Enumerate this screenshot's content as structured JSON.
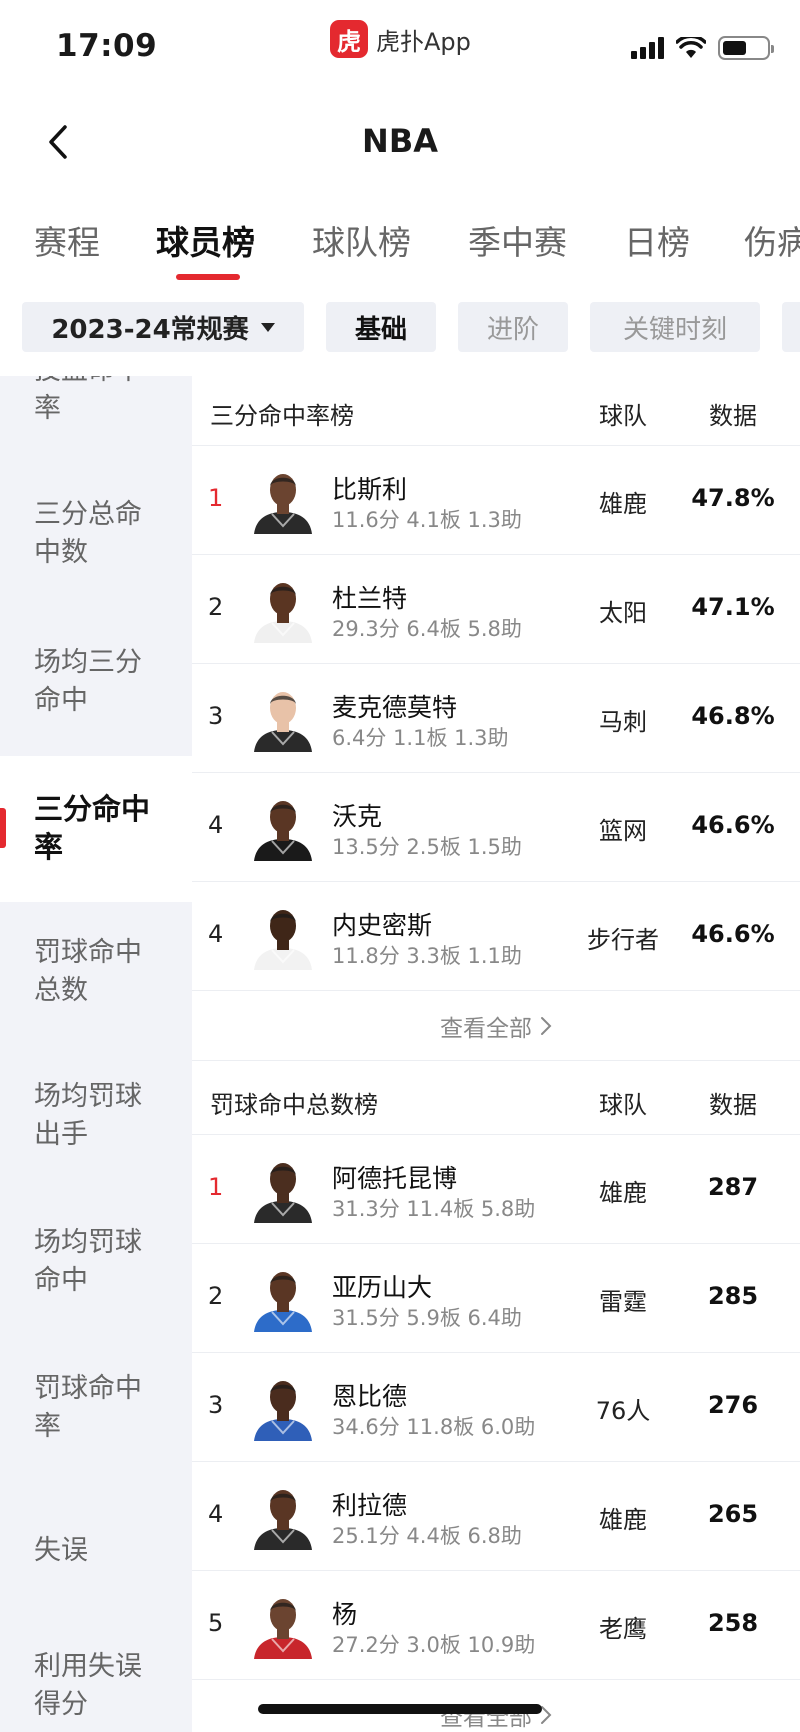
{
  "status_bar": {
    "time": "17:09",
    "app_logo_char": "虎",
    "app_name": "虎扑App"
  },
  "header": {
    "title": "NBA"
  },
  "tabs": [
    {
      "label": "赛程",
      "active": false
    },
    {
      "label": "球员榜",
      "active": true
    },
    {
      "label": "球队榜",
      "active": false
    },
    {
      "label": "季中赛",
      "active": false
    },
    {
      "label": "日榜",
      "active": false
    },
    {
      "label": "伤病",
      "active": false
    }
  ],
  "filters": {
    "season": "2023-24常规赛",
    "options": [
      {
        "label": "基础",
        "active": true
      },
      {
        "label": "进阶",
        "active": false
      },
      {
        "label": "关键时刻",
        "active": false
      }
    ]
  },
  "sidebar": {
    "items": [
      {
        "label": "投篮命中率",
        "active": false
      },
      {
        "label": "三分总命中数",
        "active": false
      },
      {
        "label": "场均三分命中",
        "active": false
      },
      {
        "label": "三分命中率",
        "active": true
      },
      {
        "label": "罚球命中总数",
        "active": false
      },
      {
        "label": "场均罚球出手",
        "active": false
      },
      {
        "label": "场均罚球命中",
        "active": false
      },
      {
        "label": "罚球命中率",
        "active": false
      },
      {
        "label": "失误",
        "active": false
      },
      {
        "label": "利用失误得分",
        "active": false
      }
    ]
  },
  "sections": [
    {
      "title": "三分命中率榜",
      "team_header": "球队",
      "data_header": "数据",
      "rows": [
        {
          "rank": "1",
          "name": "比斯利",
          "stats": "11.6分 4.1板 1.3助",
          "team": "雄鹿",
          "value": "47.8%",
          "jersey": "#2a2a2a",
          "skin": "#6b4430"
        },
        {
          "rank": "2",
          "name": "杜兰特",
          "stats": "29.3分 6.4板 5.8助",
          "team": "太阳",
          "value": "47.1%",
          "jersey": "#f0f0f0",
          "skin": "#5a3522"
        },
        {
          "rank": "3",
          "name": "麦克德莫特",
          "stats": "6.4分 1.1板 1.3助",
          "team": "马刺",
          "value": "46.8%",
          "jersey": "#2a2a2a",
          "skin": "#e8c2a8"
        },
        {
          "rank": "4",
          "name": "沃克",
          "stats": "13.5分 2.5板 1.5助",
          "team": "篮网",
          "value": "46.6%",
          "jersey": "#1a1a1a",
          "skin": "#5a3624"
        },
        {
          "rank": "4",
          "name": "内史密斯",
          "stats": "11.8分 3.3板 1.1助",
          "team": "步行者",
          "value": "46.6%",
          "jersey": "#f2f2f2",
          "skin": "#3f2618"
        }
      ],
      "see_all": "查看全部"
    },
    {
      "title": "罚球命中总数榜",
      "team_header": "球队",
      "data_header": "数据",
      "rows": [
        {
          "rank": "1",
          "name": "阿德托昆博",
          "stats": "31.3分 11.4板 5.8助",
          "team": "雄鹿",
          "value": "287",
          "jersey": "#2a2a2a",
          "skin": "#4b2e1f"
        },
        {
          "rank": "2",
          "name": "亚历山大",
          "stats": "31.5分 5.9板 6.4助",
          "team": "雷霆",
          "value": "285",
          "jersey": "#2d6cc9",
          "skin": "#5a3624"
        },
        {
          "rank": "3",
          "name": "恩比德",
          "stats": "34.6分 11.8板 6.0助",
          "team": "76人",
          "value": "276",
          "jersey": "#2f5fb8",
          "skin": "#4a2c1e"
        },
        {
          "rank": "4",
          "name": "利拉德",
          "stats": "25.1分 4.4板 6.8助",
          "team": "雄鹿",
          "value": "265",
          "jersey": "#2a2a2a",
          "skin": "#5a3624"
        },
        {
          "rank": "5",
          "name": "杨",
          "stats": "27.2分 3.0板 10.9助",
          "team": "老鹰",
          "value": "258",
          "jersey": "#c8262c",
          "skin": "#6b4430"
        }
      ],
      "see_all": "查看全部"
    }
  ],
  "colors": {
    "accent": "#e4292f",
    "sidebar_bg": "#f2f3f8",
    "chip_bg": "#eef0f5"
  }
}
